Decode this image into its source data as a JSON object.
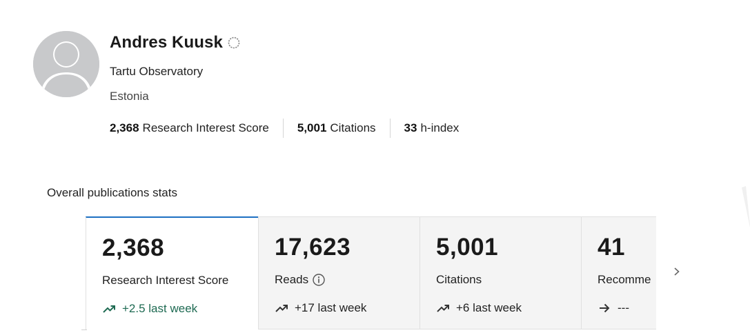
{
  "profile": {
    "name": "Andres Kuusk",
    "institution": "Tartu Observatory",
    "country": "Estonia",
    "avatar_icon": "default-user-avatar-icon",
    "badge_icon": "status-circle-icon"
  },
  "metrics": [
    {
      "value": "2,368",
      "label": "Research Interest Score"
    },
    {
      "value": "5,001",
      "label": "Citations"
    },
    {
      "value": "33",
      "label": "h-index"
    }
  ],
  "stats": {
    "title": "Overall publications stats",
    "cards": [
      {
        "value": "2,368",
        "label": "Research Interest Score",
        "trend": "+2.5 last week",
        "trend_icon": "trending-up-icon"
      },
      {
        "value": "17,623",
        "label": "Reads",
        "trend": "+17 last week",
        "trend_icon": "trending-up-icon",
        "label_icon": "info-icon"
      },
      {
        "value": "5,001",
        "label": "Citations",
        "trend": "+6 last week",
        "trend_icon": "trending-up-icon"
      },
      {
        "value": "41",
        "label": "Recomme",
        "trend": "---",
        "trend_icon": "arrow-right-icon"
      }
    ],
    "next_icon": "chevron-right-icon"
  },
  "colors": {
    "accent": "#1c6fc2",
    "trend_positive": "#1e6a52",
    "card_bg": "#f4f4f4",
    "avatar_bg": "#c8c9cb"
  }
}
